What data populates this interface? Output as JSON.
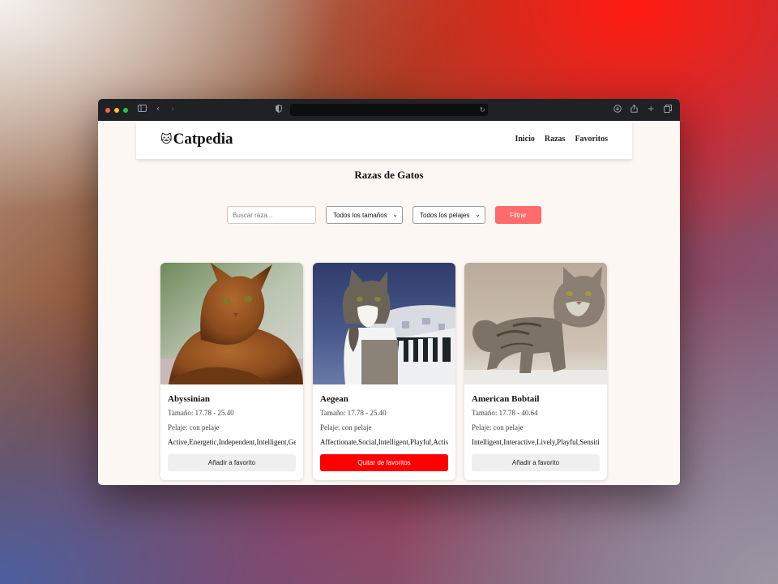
{
  "browser": {
    "url": ""
  },
  "site": {
    "brand_icon": "🐱",
    "brand": "Catpedia",
    "nav": [
      "Inicio",
      "Razas",
      "Favoritos"
    ]
  },
  "page": {
    "title": "Razas de Gatos"
  },
  "filters": {
    "search_placeholder": "Buscar raza...",
    "size_selected": "Todos los tamaños",
    "coat_selected": "Todos los pelajes",
    "filter_button": "Filtrar"
  },
  "breeds": [
    {
      "name": "Abyssinian",
      "size": "Tamaño: 17.78 - 25.40",
      "coat": "Pelaje: con pelaje",
      "temperament": "Active,Energetic,Independent,Intelligent,Gentle",
      "button": "Añadir a favorito",
      "favorite": false
    },
    {
      "name": "Aegean",
      "size": "Tamaño: 17.78 - 25.40",
      "coat": "Pelaje: con pelaje",
      "temperament": "Affectionate,Social,Intelligent,Playful,Active",
      "button": "Quitar de favoritos",
      "favorite": true
    },
    {
      "name": "American Bobtail",
      "size": "Tamaño: 17.78 - 40.64",
      "coat": "Pelaje: con pelaje",
      "temperament": "Intelligent,Interactive,Lively,Playful,Sensitive",
      "button": "Añadir a favorito",
      "favorite": false
    }
  ],
  "colors": {
    "filter_button": "#ff6b6b",
    "remove_button": "#ff0000",
    "add_button": "#efefef",
    "page_background": "#fdf7f4"
  }
}
